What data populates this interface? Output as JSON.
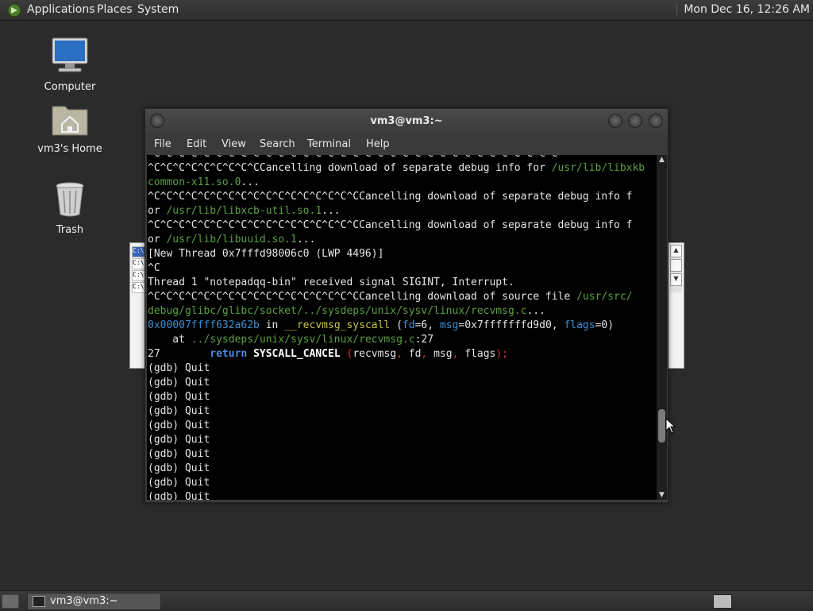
{
  "top_panel": {
    "menus": [
      "Applications",
      "Places",
      "System"
    ],
    "clock": "Mon Dec 16, 12:26 AM"
  },
  "desktop_icons": [
    {
      "label": "Computer",
      "icon": "computer-icon"
    },
    {
      "label": "vm3's Home",
      "icon": "home-folder-icon"
    },
    {
      "label": "Trash",
      "icon": "trash-icon"
    }
  ],
  "terminal": {
    "title": "vm3@vm3:~",
    "menus": [
      "File",
      "Edit",
      "View",
      "Search",
      "Terminal",
      "Help"
    ],
    "lines": [
      {
        "segs": [
          {
            "t": "^C^C^C^C^C^C^C^C^C^C^C^C^C^C^C^C^C^C^C^C^C^C^C^C^C^C^C^C^C^C^C^C^C",
            "c": ""
          }
        ]
      },
      {
        "segs": [
          {
            "t": "^C^C^C^C^C^C^C^C^CCancelling download of separate debug info for ",
            "c": ""
          },
          {
            "t": "/usr/lib/libxkb",
            "c": "c-path"
          }
        ]
      },
      {
        "segs": [
          {
            "t": "common-x11.so.0",
            "c": "c-path"
          },
          {
            "t": "...",
            "c": ""
          }
        ]
      },
      {
        "segs": [
          {
            "t": "^C^C^C^C^C^C^C^C^C^C^C^C^C^C^C^C^CCancelling download of separate debug info f",
            "c": ""
          }
        ]
      },
      {
        "segs": [
          {
            "t": "or ",
            "c": ""
          },
          {
            "t": "/usr/lib/libxcb-util.so.1",
            "c": "c-path"
          },
          {
            "t": "...",
            "c": ""
          }
        ]
      },
      {
        "segs": [
          {
            "t": "^C^C^C^C^C^C^C^C^C^C^C^C^C^C^C^C^CCancelling download of separate debug info f",
            "c": ""
          }
        ]
      },
      {
        "segs": [
          {
            "t": "or ",
            "c": ""
          },
          {
            "t": "/usr/lib/libuuid.so.1",
            "c": "c-path"
          },
          {
            "t": "...",
            "c": ""
          }
        ]
      },
      {
        "segs": [
          {
            "t": "[New Thread 0x7fffd98006c0 (LWP 4496)]",
            "c": ""
          }
        ]
      },
      {
        "segs": [
          {
            "t": "^C",
            "c": ""
          }
        ]
      },
      {
        "segs": [
          {
            "t": "Thread 1 \"notepadqq-bin\" received signal SIGINT, Interrupt.",
            "c": ""
          }
        ]
      },
      {
        "segs": [
          {
            "t": "^C^C^C^C^C^C^C^C^C^C^C^C^C^C^C^C^CCancelling download of source file ",
            "c": ""
          },
          {
            "t": "/usr/src/",
            "c": "c-path"
          }
        ]
      },
      {
        "segs": [
          {
            "t": "debug/glibc/glibc/socket/../sysdeps/unix/sysv/linux/recvmsg.c",
            "c": "c-path"
          },
          {
            "t": "...",
            "c": ""
          }
        ]
      },
      {
        "segs": [
          {
            "t": "0x00007ffff632a62b",
            "c": "c-addr"
          },
          {
            "t": " in ",
            "c": ""
          },
          {
            "t": "__recvmsg_syscall",
            "c": "c-yel"
          },
          {
            "t": " (",
            "c": ""
          },
          {
            "t": "fd",
            "c": "c-addr"
          },
          {
            "t": "=6, ",
            "c": ""
          },
          {
            "t": "msg",
            "c": "c-addr"
          },
          {
            "t": "=0x7fffffffd9d0, ",
            "c": ""
          },
          {
            "t": "flags",
            "c": "c-addr"
          },
          {
            "t": "=0)",
            "c": ""
          }
        ]
      },
      {
        "segs": [
          {
            "t": "    at ",
            "c": ""
          },
          {
            "t": "../sysdeps/unix/sysv/linux/recvmsg.c",
            "c": "c-path"
          },
          {
            "t": ":27",
            "c": ""
          }
        ]
      },
      {
        "segs": [
          {
            "t": "27        ",
            "c": ""
          },
          {
            "t": "return",
            "c": "c-kw"
          },
          {
            "t": " ",
            "c": ""
          },
          {
            "t": "SYSCALL_CANCEL",
            "c": "c-bold"
          },
          {
            "t": " (",
            "c": "c-red"
          },
          {
            "t": "recvmsg",
            "c": ""
          },
          {
            "t": ", ",
            "c": "c-red"
          },
          {
            "t": "fd",
            "c": ""
          },
          {
            "t": ", ",
            "c": "c-red"
          },
          {
            "t": "msg",
            "c": ""
          },
          {
            "t": ", ",
            "c": "c-red"
          },
          {
            "t": "flags",
            "c": ""
          },
          {
            "t": ");",
            "c": "c-red"
          }
        ]
      },
      {
        "segs": [
          {
            "t": "(gdb) Quit",
            "c": ""
          }
        ]
      },
      {
        "segs": [
          {
            "t": "(gdb) Quit",
            "c": ""
          }
        ]
      },
      {
        "segs": [
          {
            "t": "(gdb) Quit",
            "c": ""
          }
        ]
      },
      {
        "segs": [
          {
            "t": "(gdb) Quit",
            "c": ""
          }
        ]
      },
      {
        "segs": [
          {
            "t": "(gdb) Quit",
            "c": ""
          }
        ]
      },
      {
        "segs": [
          {
            "t": "(gdb) Quit",
            "c": ""
          }
        ]
      },
      {
        "segs": [
          {
            "t": "(gdb) Quit",
            "c": ""
          }
        ]
      },
      {
        "segs": [
          {
            "t": "(gdb) Quit",
            "c": ""
          }
        ]
      },
      {
        "segs": [
          {
            "t": "(gdb) Quit",
            "c": ""
          }
        ]
      },
      {
        "segs": [
          {
            "t": "(gdb) Quit",
            "c": ""
          }
        ]
      }
    ]
  },
  "background_window": {
    "row_labels": [
      "C:\\",
      "C:\\",
      "C:\\",
      "C:\\"
    ]
  },
  "taskbar": {
    "task_label": "vm3@vm3:~"
  }
}
